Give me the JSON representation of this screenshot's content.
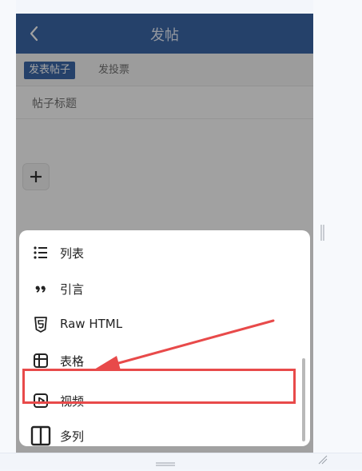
{
  "header": {
    "title": "发帖"
  },
  "tabs": [
    {
      "label": "发表帖子",
      "active": true
    },
    {
      "label": "发投票",
      "active": false
    }
  ],
  "post_title_placeholder": "帖子标题",
  "menu": [
    {
      "label": "列表",
      "icon": "list-icon"
    },
    {
      "label": "引言",
      "icon": "quote-icon"
    },
    {
      "label": "Raw HTML",
      "icon": "html5-icon"
    },
    {
      "label": "表格",
      "icon": "table-icon"
    },
    {
      "label": "视频",
      "icon": "video-icon",
      "highlighted": true
    },
    {
      "label": "多列",
      "icon": "columns-icon"
    }
  ],
  "colors": {
    "header": "#2a5aa0",
    "highlight": "#e84a4a"
  }
}
